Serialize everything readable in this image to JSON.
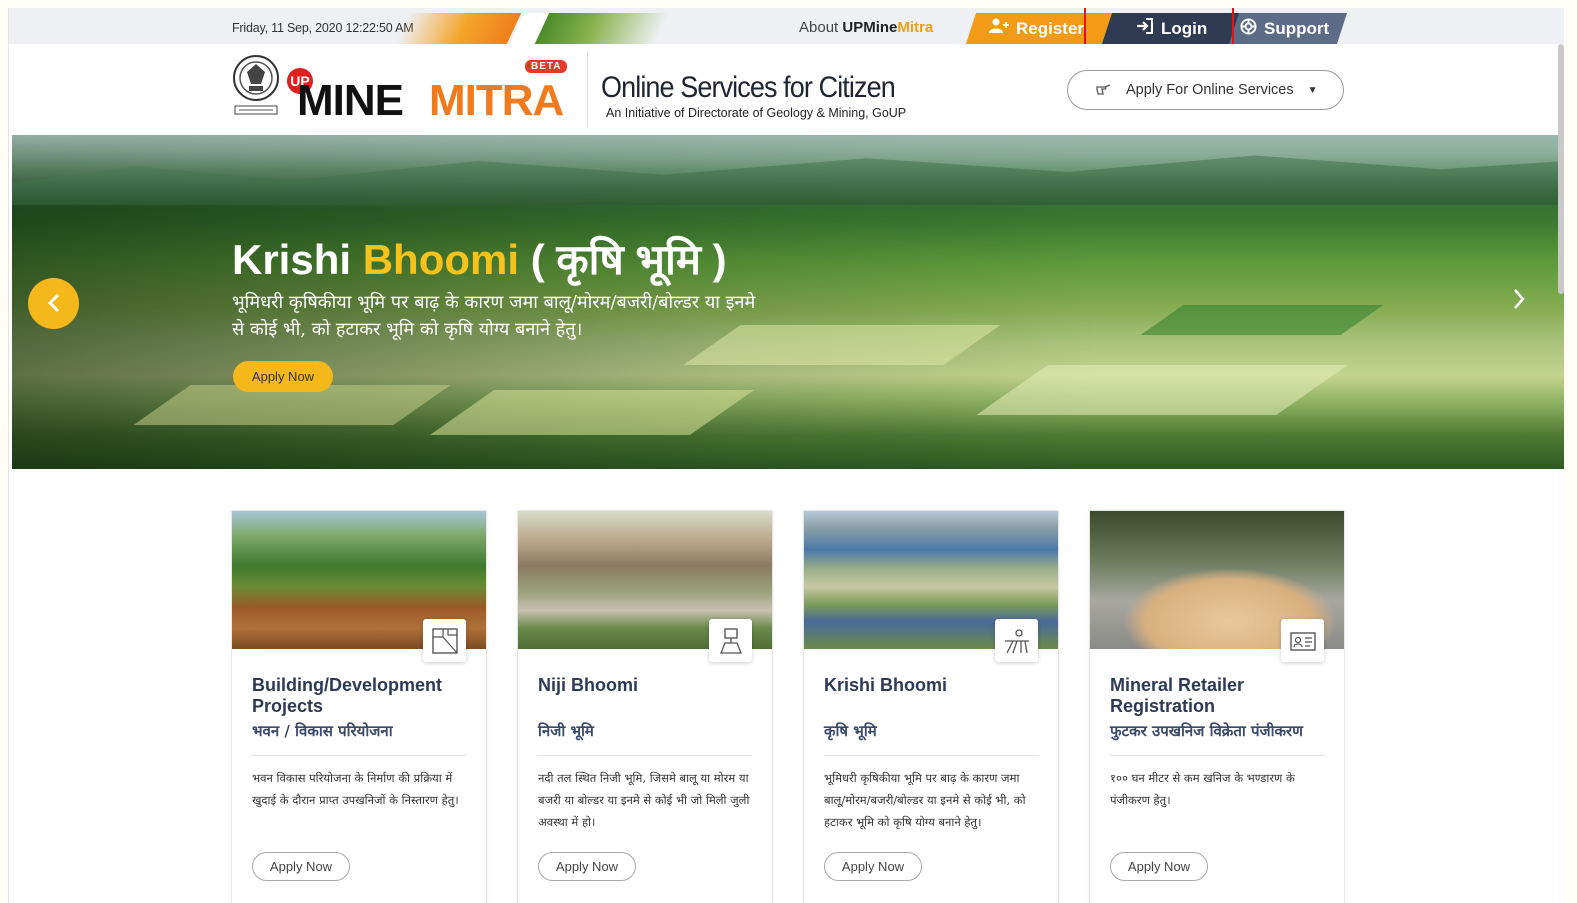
{
  "topbar": {
    "datetime": "Friday, 11 Sep, 2020 12:22:50 AM",
    "about_prefix": "About",
    "about_brand": "UPMine",
    "about_brand_accent": "Mitra",
    "register_label": "Register",
    "login_label": "Login",
    "support_label": "Support"
  },
  "header": {
    "logo_up": "UP",
    "logo_mine": "MINE",
    "logo_mitra": "MITRA",
    "beta_label": "BETA",
    "title": "Online Services for Citizen",
    "subtitle": "An Initiative of Directorate of Geology & Mining, GoUP",
    "apply_online_label": "Apply For Online Services"
  },
  "hero": {
    "title_part1": "Krishi",
    "title_part2": "Bhoomi",
    "title_part3": "( कृषि भूमि )",
    "description": "भूमिधरी कृषिकीया भूमि पर बाढ़ के कारण जमा बालू/मोरम/बजरी/बोल्डर या इनमे से कोई भी, को हटाकर भूमि को कृषि योग्य बनाने हेतु।",
    "apply_label": "Apply Now"
  },
  "cards": [
    {
      "title": "Building/Development Projects",
      "hindi": "भवन / विकास परियोजना",
      "description": "भवन विकास परियोजना के निर्माण की प्रक्रिया में खुदाई के दौरान प्राप्त उपखनिजों के निस्तारण हेतु।",
      "apply_label": "Apply Now",
      "icon": "blueprint-icon"
    },
    {
      "title": "Niji Bhoomi",
      "hindi": "निजी भूमि",
      "description": "नदी तल स्थित निजी भूमि, जिसमे बालू या मोरम या बजरी या बोल्डर या इनमे से कोई भी जो मिली जुली अवस्था में हो।",
      "apply_label": "Apply Now",
      "icon": "land-survey-icon"
    },
    {
      "title": "Krishi Bhoomi",
      "hindi": "कृषि भूमि",
      "description": "भूमिधरी कृषिकीया भूमि पर बाढ़ के कारण जमा बालू/मोरम/बजरी/बोल्डर या इनमे से कोई भी, को हटाकर भूमि को कृषि योग्य बनाने हेतु।",
      "apply_label": "Apply Now",
      "icon": "farm-field-icon"
    },
    {
      "title": "Mineral Retailer Registration",
      "hindi": "फुटकर उपखनिज विक्रेता पंजीकरण",
      "description": "१०० घन मीटर से कम खनिज के भण्डारण के पंजीकरण हेतु।",
      "apply_label": "Apply Now",
      "icon": "id-card-icon"
    }
  ],
  "colors": {
    "accent_orange": "#f39a16",
    "accent_yellow": "#f4b81a",
    "login_dark": "#2f3b52",
    "support_slate": "#5c6c86",
    "highlight_red": "#e8101a"
  }
}
